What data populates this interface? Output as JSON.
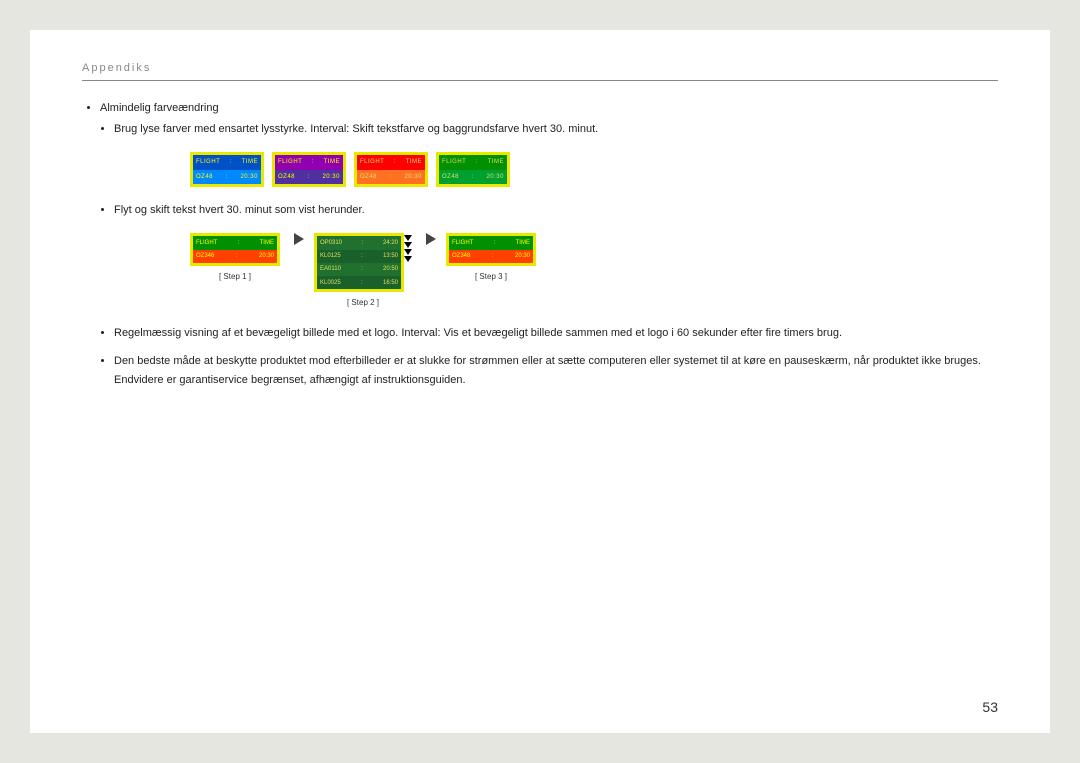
{
  "header": {
    "title": "Appendiks"
  },
  "bullets": {
    "b1": "Almindelig farveændring",
    "b1s1": "Brug lyse farver med ensartet lysstyrke. Interval: Skift tekstfarve og baggrundsfarve hvert 30. minut.",
    "b1s2": "Flyt og skift tekst hvert 30. minut som vist herunder.",
    "b1s3": "Regelmæssig visning af et bevægeligt billede med et logo. Interval: Vis et bevægeligt billede sammen med et logo i 60 sekunder efter fire timers brug.",
    "b1s4": "Den bedste måde at beskytte produktet mod efterbilleder er at slukke for strømmen eller at sætte computeren eller systemet til at køre en pauseskærm, når produktet ikke bruges. Endvidere er garantiservice begrænset, afhængigt af instruktionsguiden."
  },
  "boards": {
    "h_flight": "FLIGHT",
    "h_sep": ":",
    "h_time": "TIME",
    "r_code": "OZ48",
    "r_time": "20:30"
  },
  "steps": {
    "s1": {
      "h_flight": "FLIGHT",
      "h_time": "TIME",
      "code": "OZ346",
      "time": "20:30",
      "label": "[ Step 1 ]"
    },
    "s2": {
      "rows": [
        {
          "a": "OP0310",
          "b": "24:20"
        },
        {
          "a": "KL0125",
          "b": "13:50"
        },
        {
          "a": "EA0110",
          "b": "20:50"
        },
        {
          "a": "KL0025",
          "b": "16:50"
        }
      ],
      "label": "[ Step 2 ]"
    },
    "s3": {
      "h_flight": "FLIGHT",
      "h_time": "TIME",
      "code": "OZ348",
      "time": "20:30",
      "label": "[ Step 3 ]"
    }
  },
  "page_number": "53"
}
